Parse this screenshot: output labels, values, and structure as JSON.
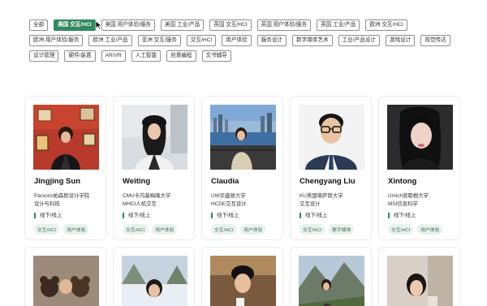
{
  "filters": [
    {
      "label": "全部",
      "active": false
    },
    {
      "label": "美国 交互/HCI",
      "active": true
    },
    {
      "label": "美国 用户体验/服务",
      "active": false
    },
    {
      "label": "美国 工业/产品",
      "active": false
    },
    {
      "label": "英国 交互/HCI",
      "active": false
    },
    {
      "label": "英国 用户体验/服务",
      "active": false
    },
    {
      "label": "英国 工业/产品",
      "active": false
    },
    {
      "label": "欧洲 交互/HCI",
      "active": false
    },
    {
      "label": "欧洲 用户体验/服务",
      "active": false
    },
    {
      "label": "欧洲 工业/产品",
      "active": false
    },
    {
      "label": "亚洲 交互/服务",
      "active": false
    },
    {
      "label": "交互/HCI",
      "active": false
    },
    {
      "label": "用户体验",
      "active": false
    },
    {
      "label": "服务设计",
      "active": false
    },
    {
      "label": "数字媒体艺术",
      "active": false
    },
    {
      "label": "工业/产品设计",
      "active": false
    },
    {
      "label": "游戏设计",
      "active": false
    },
    {
      "label": "视觉传达",
      "active": false
    },
    {
      "label": "设计管理",
      "active": false
    },
    {
      "label": "硬件/装置",
      "active": false
    },
    {
      "label": "AR/VR",
      "active": false
    },
    {
      "label": "人工智能",
      "active": false
    },
    {
      "label": "创意编程",
      "active": false
    },
    {
      "label": "文书辅导",
      "active": false
    }
  ],
  "mentors": [
    {
      "name": "Jingjing Sun",
      "line1": "Parsons帕森斯设计学院",
      "line2": "设计与科技",
      "mode": "线下/线上",
      "tags": [
        "交互/HCI",
        "用户体验"
      ]
    },
    {
      "name": "Weiting",
      "line1": "CMU卡内基梅隆大学",
      "line2": "MHCI人机交互",
      "mode": "线下/线上",
      "tags": [
        "交互/HCI",
        "用户体验"
      ]
    },
    {
      "name": "Claudia",
      "line1": "UW华盛顿大学",
      "line2": "HCDE交互设计",
      "mode": "线下/线上",
      "tags": [
        "交互/HCI",
        "用户体验"
      ]
    },
    {
      "name": "Chengyang Liu",
      "line1": "KU美国堪萨斯大学",
      "line2": "交互设计",
      "mode": "线下/线上",
      "tags": [
        "交互/HCI",
        "数字媒体"
      ]
    },
    {
      "name": "Xintong",
      "line1": "Umich密歇根大学",
      "line2": "MSI信息科学",
      "mode": "线下/线上",
      "tags": [
        "交互/HCI",
        "用户体验"
      ]
    }
  ],
  "colors": {
    "accent": "#2f8a5f",
    "tag_bg": "#e9f3ee"
  }
}
